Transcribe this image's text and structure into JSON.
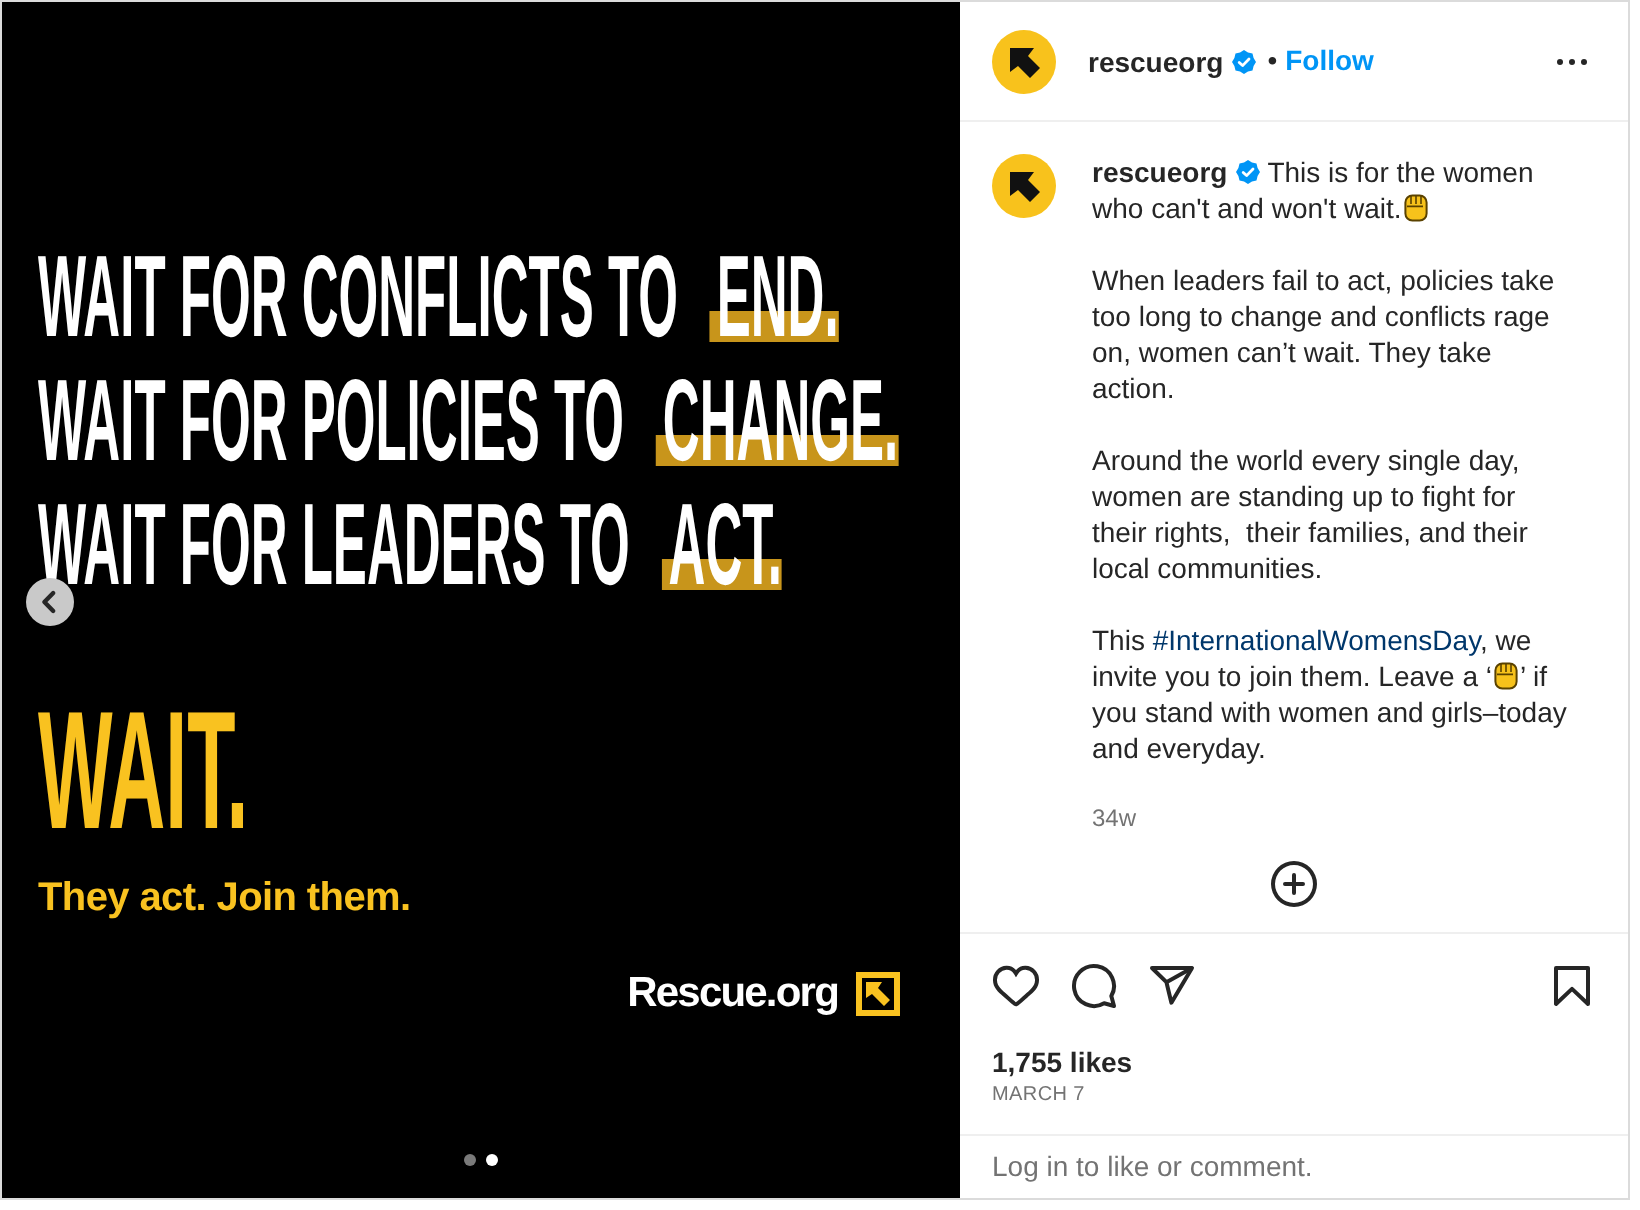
{
  "post_image": {
    "lines": [
      {
        "text": "WAIT FOR CONFLICTS TO",
        "highlight": "END."
      },
      {
        "text": "WAIT FOR POLICIES TO",
        "highlight": "CHANGE."
      },
      {
        "text": "WAIT FOR LEADERS TO",
        "highlight": "ACT."
      }
    ],
    "headline": "WAIT.",
    "tagline": "They act. Join them.",
    "logo_text": "Rescue.org",
    "slides": [
      {
        "selected": false
      },
      {
        "selected": true
      }
    ]
  },
  "header": {
    "username": "rescueorg",
    "verified": true,
    "separator": "•",
    "follow": "Follow"
  },
  "caption": {
    "username": "rescueorg",
    "verified": true,
    "paragraphs": [
      [
        {
          "kind": "text",
          "text": "This is for the women who can't and won't wait."
        },
        {
          "kind": "emoji"
        }
      ],
      [
        {
          "kind": "text",
          "text": "When leaders fail to act, policies take too long to change and conflicts rage on, women can’t wait. They take action."
        }
      ],
      [
        {
          "kind": "text",
          "text": "Around the world every single day, women are standing up to fight for their rights,  their families, and their local communities."
        }
      ],
      [
        {
          "kind": "text",
          "text": "This "
        },
        {
          "kind": "hashtag",
          "text": "#InternationalWomensDay"
        },
        {
          "kind": "text",
          "text": ", we invite you to join them. Leave a ‘"
        },
        {
          "kind": "emoji"
        },
        {
          "kind": "text",
          "text": "’ if you stand with women and girls–today and everyday."
        }
      ]
    ],
    "time": "34w"
  },
  "likes": "1,755 likes",
  "date": "MARCH 7",
  "login": {
    "link": "Log in",
    "text": "to like or comment."
  }
}
